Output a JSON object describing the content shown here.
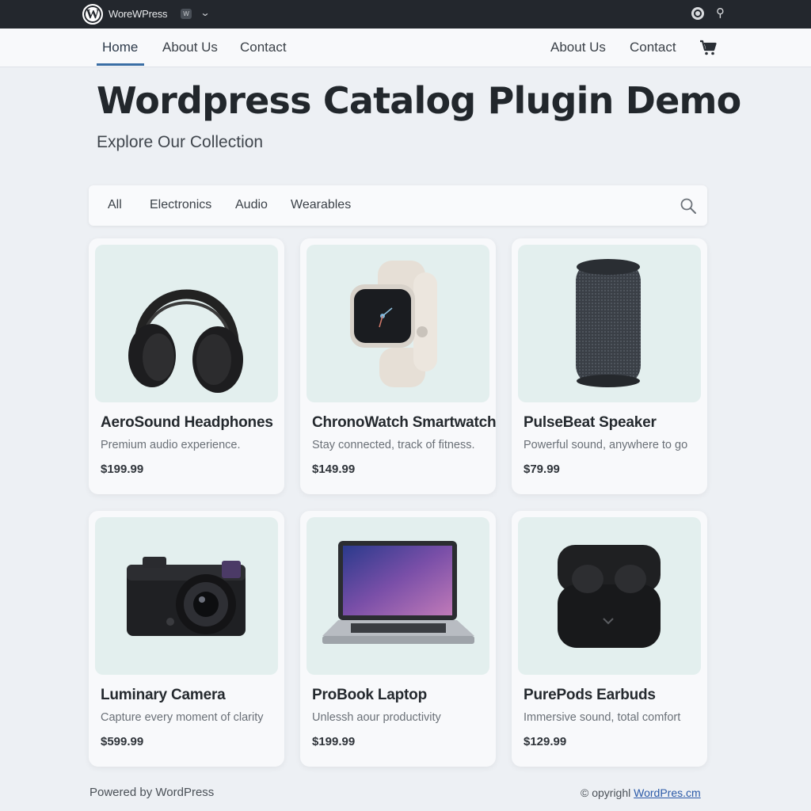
{
  "admin_bar": {
    "site_name": "WoreWPress",
    "badge": "W"
  },
  "nav": {
    "left": [
      "Home",
      "About Us",
      "Contact"
    ],
    "right": [
      "About Us",
      "Contact"
    ]
  },
  "hero": {
    "title": "Wordpress Catalog Plugin Demo",
    "subtitle": "Explore Our Collection"
  },
  "filters": [
    "All",
    "Electronics",
    "Audio",
    "Wearables"
  ],
  "products": [
    {
      "title": "AeroSound Headphones",
      "desc": "Premium audio experience.",
      "price": "$199.99",
      "image": "headphones"
    },
    {
      "title": "ChronoWatch Smartwatch",
      "desc": "Stay connected, track of fitness.",
      "price": "$149.99",
      "image": "smartwatch"
    },
    {
      "title": "PulseBeat Speaker",
      "desc": "Powerful sound, anywhere to go",
      "price": "$79.99",
      "image": "speaker"
    },
    {
      "title": "Luminary Camera",
      "desc": "Capture every moment of clarity",
      "price": "$599.99",
      "image": "camera"
    },
    {
      "title": "ProBook Laptop",
      "desc": "Unlessh aour productivity",
      "price": "$199.99",
      "image": "laptop"
    },
    {
      "title": "PurePods Earbuds",
      "desc": "Immersive sound, total comfort",
      "price": "$129.99",
      "image": "earbuds"
    }
  ],
  "footer": {
    "left": "Powered by WordPress",
    "copyright": "© opyrighl",
    "link": "WordPres.cm"
  },
  "colors": {
    "admin_bar": "#23272d",
    "accent": "#3a6ea5",
    "image_bg": "#e3efee",
    "page_bg": "#edf0f4"
  }
}
